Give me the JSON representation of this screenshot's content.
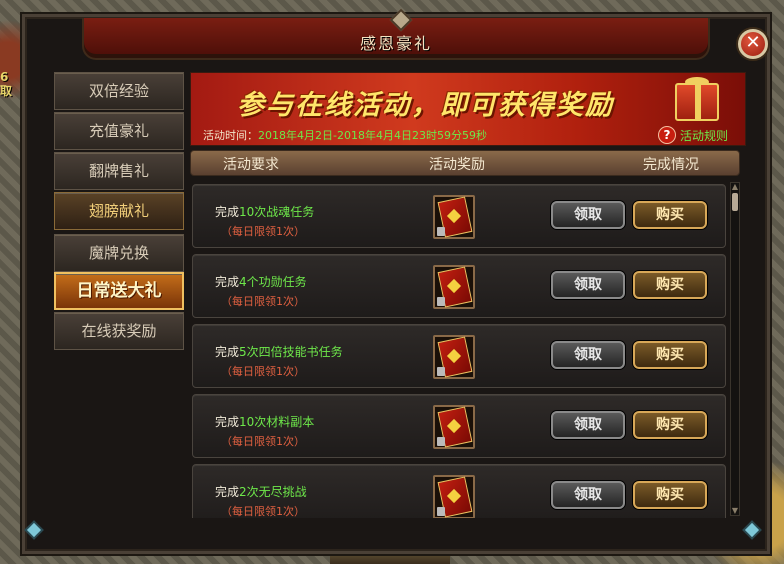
{
  "window": {
    "title": "感恩豪礼",
    "close_glyph": "✕"
  },
  "scene": {
    "left_fragment": "6",
    "left_fragment2": "取"
  },
  "sidebar": {
    "items": [
      {
        "label": "双倍经验"
      },
      {
        "label": "充值豪礼"
      },
      {
        "label": "翻牌售礼"
      },
      {
        "label": "翅膀献礼"
      },
      {
        "label": "魔牌兑换"
      },
      {
        "label": "日常送大礼"
      },
      {
        "label": "在线获奖励"
      }
    ],
    "active_index": 5
  },
  "banner": {
    "headline": "参与在线活动，即可获得奖励",
    "time_label": "活动时间：",
    "time_value": "2018年4月2日-2018年4月4日23时59分59秒",
    "help_glyph": "?",
    "rules_link": "活动规则"
  },
  "table": {
    "headers": [
      "活动要求",
      "活动奖励",
      "完成情况"
    ],
    "rows": [
      {
        "prefix": "完成",
        "highlight": "10次战魂任务",
        "suffix": "",
        "limit": "（每日限领1次）",
        "claim": "领取",
        "buy": "购买"
      },
      {
        "prefix": "完成",
        "highlight": "4个功勋任务",
        "suffix": "",
        "limit": "（每日限领1次）",
        "claim": "领取",
        "buy": "购买"
      },
      {
        "prefix": "完成",
        "highlight": "5次四倍技能书任务",
        "suffix": "",
        "limit": "（每日限领1次）",
        "claim": "领取",
        "buy": "购买"
      },
      {
        "prefix": "完成",
        "highlight": "10次材料副本",
        "suffix": "",
        "limit": "（每日限领1次）",
        "claim": "领取",
        "buy": "购买"
      },
      {
        "prefix": "完成",
        "highlight": "2次无尽挑战",
        "suffix": "",
        "limit": "（每日限领1次）",
        "claim": "领取",
        "buy": "购买"
      }
    ]
  },
  "colors": {
    "highlight_text": "#6ee84a",
    "limit_text": "#e06040",
    "active_tab": "#c46e1a"
  },
  "icons": {
    "close": "close-icon",
    "help": "help-icon",
    "reward": "reward-card-icon",
    "lock": "lock-icon",
    "gift": "gift-box-icon"
  }
}
